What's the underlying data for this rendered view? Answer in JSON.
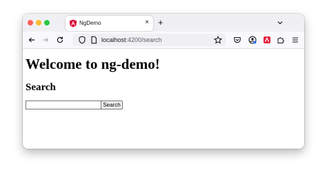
{
  "browser": {
    "tab": {
      "title": "NgDemo",
      "close_glyph": "×",
      "icon": "angular-logo-icon",
      "icon_color": "#dd0031"
    },
    "new_tab_glyph": "+",
    "address": {
      "host": "localhost",
      "rest": ":4200/search"
    }
  },
  "page": {
    "heading": "Welcome to ng-demo!",
    "subheading": "Search",
    "search_input": {
      "value": "",
      "placeholder": ""
    },
    "search_button_label": "Search"
  }
}
